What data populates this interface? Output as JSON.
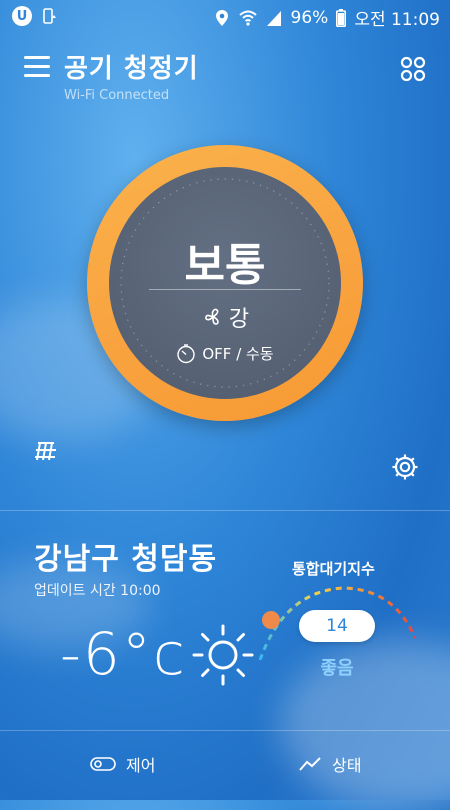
{
  "status_bar": {
    "app_badge": "U",
    "battery": "96%",
    "time": "오전 11:09"
  },
  "header": {
    "title": "공기 청정기",
    "subtitle": "Wi-Fi Connected"
  },
  "dial": {
    "mode": "보통",
    "fan_speed": "강",
    "timer": "OFF / 수동"
  },
  "location": {
    "name": "강남구 청담동",
    "update": "업데이트 시간 10:00"
  },
  "weather": {
    "temperature": "-6°c",
    "icon": "sun-icon"
  },
  "air_quality": {
    "title": "통합대기지수",
    "index": "14",
    "status": "좋음"
  },
  "nav": {
    "control_label": "제어",
    "status_label": "상태"
  },
  "colors": {
    "dial_ring": "#f8a340",
    "dial_inner": "#566174",
    "air_quality_text": "#8fd0ff",
    "arc_start": "#39b6f0",
    "arc_end": "#e8453c"
  }
}
